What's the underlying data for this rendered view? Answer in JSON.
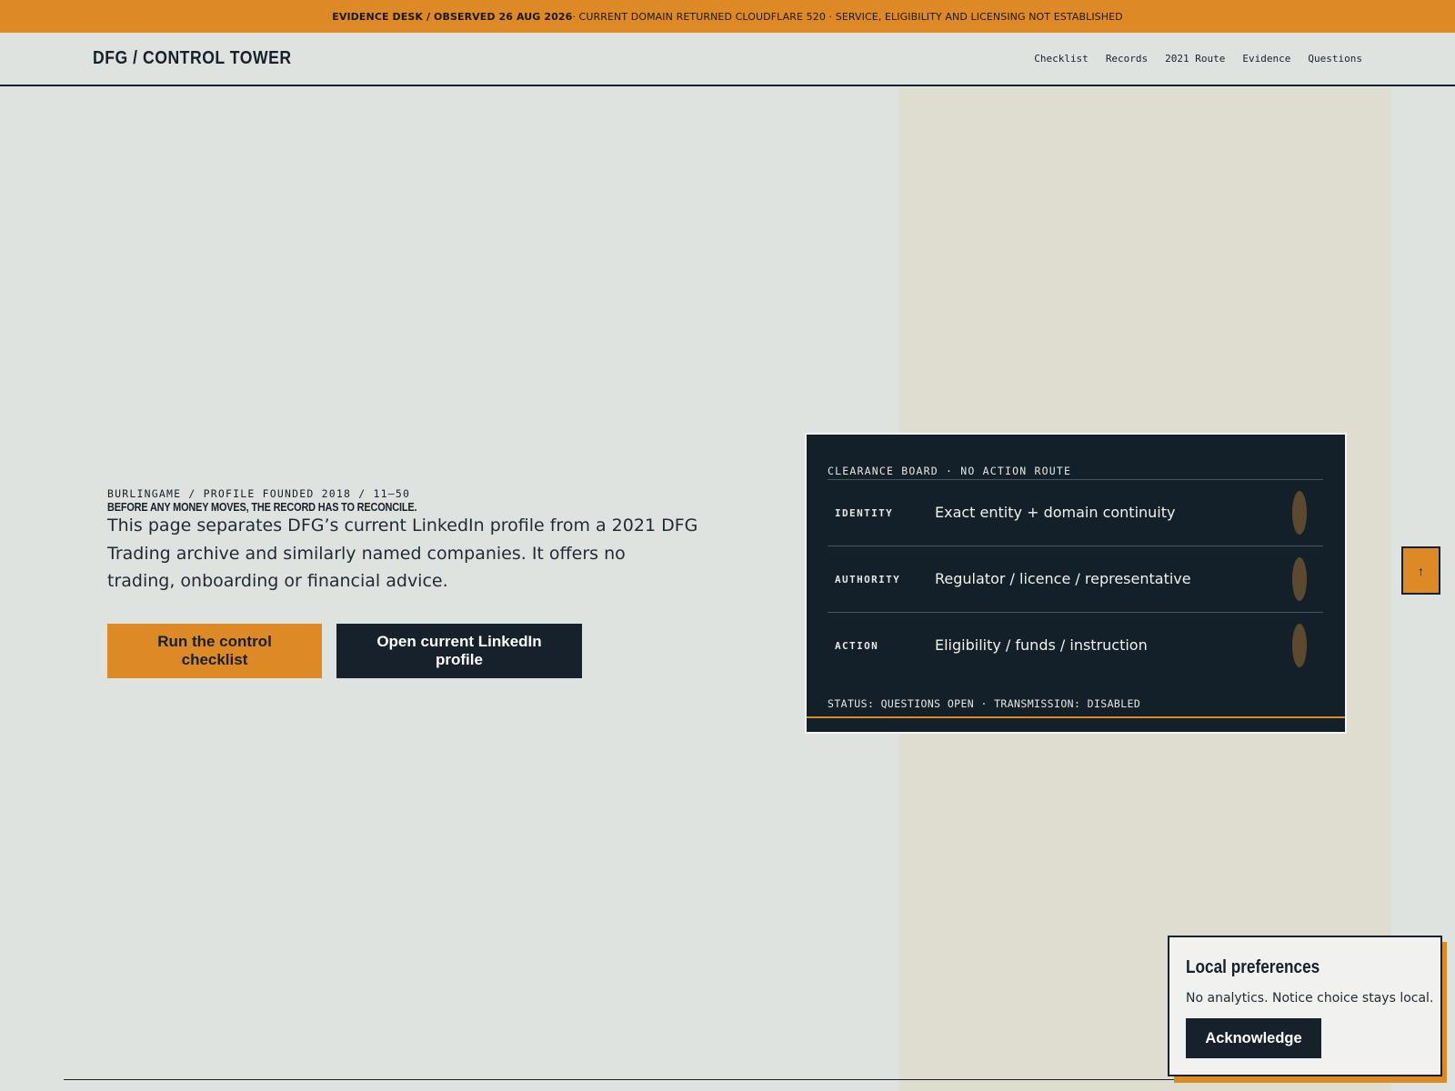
{
  "notice": {
    "lead": "EVIDENCE DESK / OBSERVED 26 AUG 2026",
    "text": " · CURRENT DOMAIN RETURNED CLOUDFLARE 520 · SERVICE, ELIGIBILITY AND LICENSING NOT ESTABLISHED"
  },
  "header": {
    "brand": "DFG / CONTROL TOWER",
    "nav": [
      "Checklist",
      "Records",
      "2021 Route",
      "Evidence",
      "Questions"
    ]
  },
  "hero": {
    "eyebrow": "BURLINGAME / PROFILE FOUNDED 2018 / 11–50",
    "tagline": "BEFORE ANY MONEY MOVES, THE RECORD HAS TO RECONCILE.",
    "lede": "This page separates DFG’s current LinkedIn profile from a 2021 DFG Trading archive and similarly named companies. It offers no trading, onboarding or financial advice.",
    "primary_button": "Run the control checklist",
    "secondary_button": "Open current LinkedIn profile"
  },
  "board": {
    "title": "CLEARANCE BOARD · NO ACTION ROUTE",
    "rows": [
      {
        "key": "IDENTITY",
        "value": "Exact entity + domain continuity"
      },
      {
        "key": "AUTHORITY",
        "value": "Regulator / licence / representative"
      },
      {
        "key": "ACTION",
        "value": "Eligibility / funds / instruction"
      }
    ],
    "status": "STATUS: QUESTIONS OPEN · TRANSMISSION: DISABLED"
  },
  "back_to_top": {
    "icon": "arrow-up-icon",
    "glyph": "↑"
  },
  "prefs": {
    "title": "Local preferences",
    "text": "No analytics. Notice choice stays local.",
    "button": "Acknowledge"
  },
  "colors": {
    "accent": "#dd8a26",
    "ink": "#16212b",
    "background": "#dfe3df",
    "beige": "#dfdcd0"
  }
}
